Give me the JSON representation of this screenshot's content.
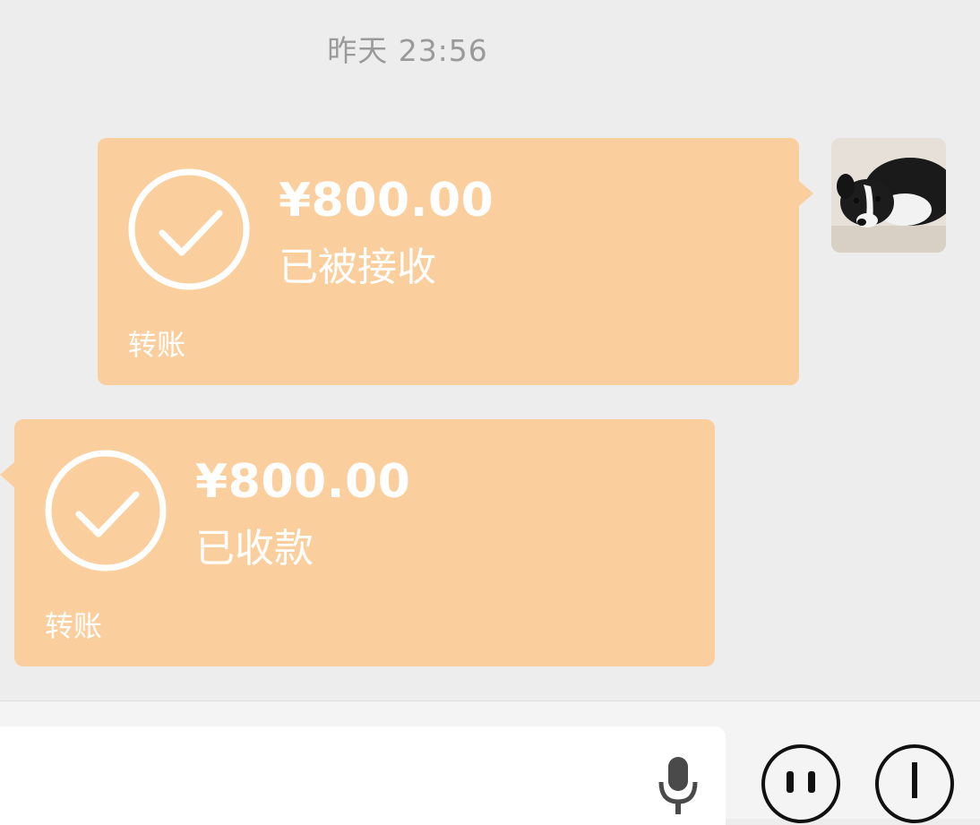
{
  "chat": {
    "timestamp": "昨天 23:56",
    "messages": [
      {
        "direction": "sent",
        "type": "transfer",
        "amount": "¥800.00",
        "status": "已被接收",
        "label": "转账"
      },
      {
        "direction": "received",
        "type": "transfer",
        "amount": "¥800.00",
        "status": "已收款",
        "label": "转账"
      }
    ]
  },
  "avatar": {
    "icon": "dog-avatar"
  },
  "input_bar": {
    "value": "",
    "voice_icon": "microphone-icon",
    "emoji_icon": "emoji-icon",
    "more_icon": "plus-icon"
  },
  "colors": {
    "background": "#ededed",
    "transfer_bubble": "#fbcf9d",
    "text_on_bubble": "#ffffff",
    "timestamp": "#9a9a9a"
  }
}
